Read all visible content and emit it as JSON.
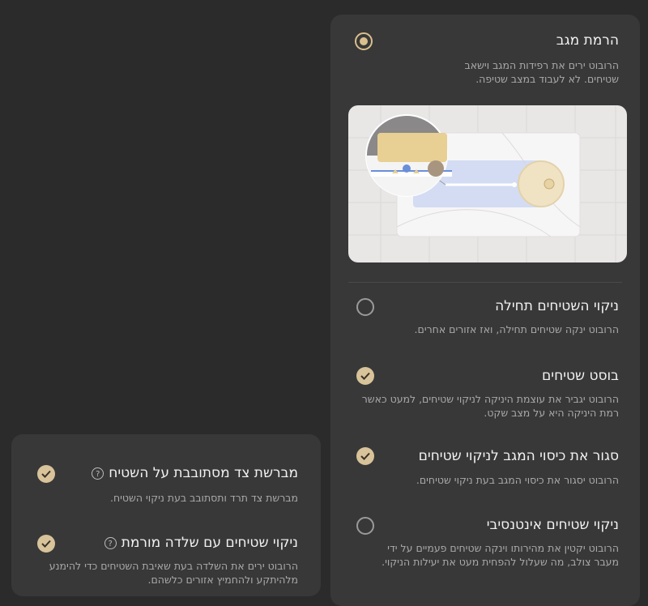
{
  "right_panel": {
    "items": [
      {
        "title": "הרמת מגב",
        "desc": "הרובוט ירים את רפידות המגב וישאב שטיחים. לא לעבוד במצב שטיפה.",
        "control": "radio-selected"
      },
      {
        "title": "ניקוי השטיחים תחילה",
        "desc": "הרובוט ינקה שטיחים תחילה, ואז אזורים אחרים.",
        "control": "radio"
      },
      {
        "title": "בוסט שטיחים",
        "desc": "הרובוט יגביר את עוצמת היניקה לניקוי שטיחים, למעט כאשר רמת היניקה היא על מצב שקט.",
        "control": "checkbox-checked"
      },
      {
        "title": "סגור את כיסוי המגב לניקוי שטיחים",
        "desc": "הרובוט יסגור את כיסוי המגב בעת ניקוי שטיחים.",
        "control": "checkbox-checked"
      },
      {
        "title": "ניקוי שטיחים אינטנסיבי",
        "desc": "הרובוט יקטין את מהירותו וינקה שטיחים פעמיים על ידי מעבר צולב, מה שעלול להפחית מעט את יעילות הניקוי.",
        "control": "radio"
      }
    ]
  },
  "left_panel": {
    "items": [
      {
        "title": "מברשת צד מסתובבת על השטיח",
        "desc": "מברשת צד תרד ותסתובב בעת ניקוי השטיח.",
        "control": "checkbox-checked",
        "help": "?"
      },
      {
        "title": "ניקוי שטיחים עם שלדה מורמת",
        "desc": "הרובוט ירים את השלדה בעת שאיבת השטיחים כדי להימנע מלהיתקע ולהחמיץ אזורים כלשהם.",
        "control": "checkbox-checked",
        "help": "?"
      }
    ]
  },
  "colors": {
    "accent": "#d9bf8e",
    "background": "#2b2b2b",
    "panel": "#383838"
  }
}
